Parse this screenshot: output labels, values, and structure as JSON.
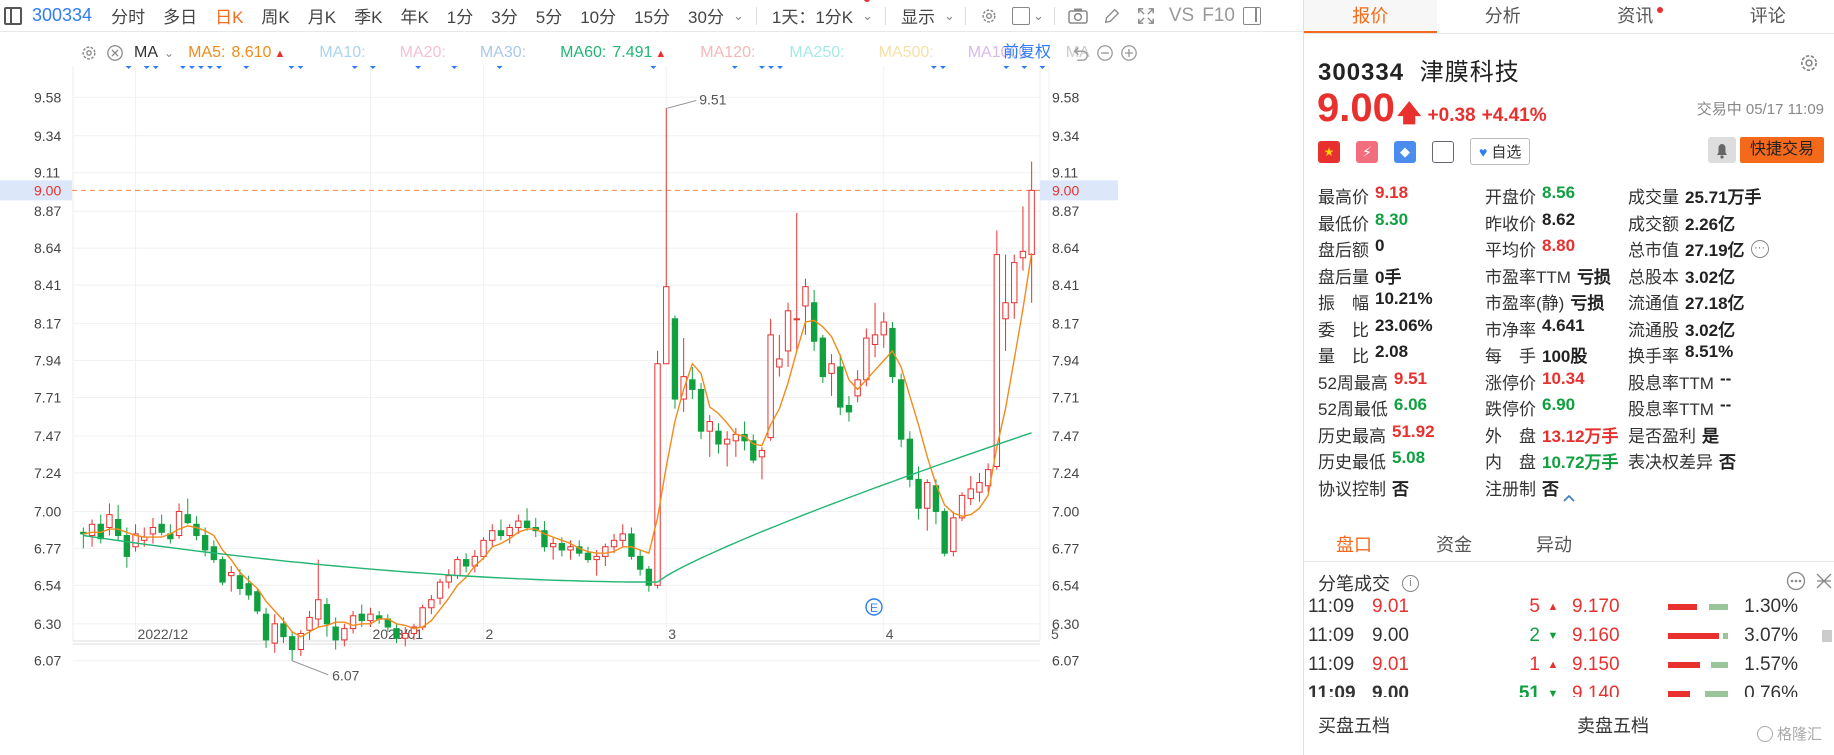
{
  "toolbar": {
    "code": "300334",
    "periods": [
      "分时",
      "多日",
      "日K",
      "周K",
      "月K",
      "季K",
      "年K",
      "1分",
      "3分",
      "5分",
      "10分",
      "15分",
      "30分"
    ],
    "active_period": "日K",
    "interval_select": "1天：1分K",
    "display_label": "显示",
    "vs_label": "VS",
    "f10_label": "F10"
  },
  "ma_bar": {
    "label": "MA",
    "items": [
      {
        "name": "MA5:",
        "value": "8.610",
        "color": "#f28a1c",
        "arrow": "▲"
      },
      {
        "name": "MA10:",
        "value": "",
        "color": "#a9d4f2"
      },
      {
        "name": "MA20:",
        "value": "",
        "color": "#f5c0d8"
      },
      {
        "name": "MA30:",
        "value": "",
        "color": "#a9c8ec"
      },
      {
        "name": "MA60:",
        "value": "7.491",
        "color": "#22b573",
        "arrow": "▲"
      },
      {
        "name": "MA120:",
        "value": "",
        "color": "#f5b8b8"
      },
      {
        "name": "MA250:",
        "value": "",
        "color": "#a8e8e8"
      },
      {
        "name": "MA500:",
        "value": "",
        "color": "#f8e0a8"
      },
      {
        "name": "MA1000:",
        "value": "",
        "color": "#d8b8e8"
      },
      {
        "name": "MA",
        "value": "",
        "color": "#cccccc"
      }
    ],
    "adjust_label": "前复权"
  },
  "chart_data": {
    "type": "candlestick",
    "y_ticks": [
      9.58,
      9.34,
      9.11,
      8.87,
      8.64,
      8.41,
      8.17,
      7.94,
      7.71,
      7.47,
      7.24,
      7.0,
      6.77,
      6.54,
      6.3,
      6.07
    ],
    "ylim": [
      5.95,
      9.7
    ],
    "x_ticks": [
      "2022/12",
      "2023/01",
      "2",
      "3",
      "4",
      "5"
    ],
    "current_price_line": "9.00",
    "max_annotation": "9.51",
    "min_annotation": "6.07",
    "candles": [
      [
        6.87,
        6.9,
        6.77,
        6.86
      ],
      [
        6.85,
        6.95,
        6.78,
        6.92
      ],
      [
        6.92,
        6.98,
        6.8,
        6.83
      ],
      [
        6.9,
        7.05,
        6.85,
        6.98
      ],
      [
        6.95,
        7.04,
        6.82,
        6.85
      ],
      [
        6.85,
        6.9,
        6.65,
        6.72
      ],
      [
        6.78,
        6.92,
        6.75,
        6.86
      ],
      [
        6.82,
        6.9,
        6.78,
        6.84
      ],
      [
        6.86,
        6.96,
        6.8,
        6.9
      ],
      [
        6.92,
        6.98,
        6.85,
        6.87
      ],
      [
        6.86,
        6.92,
        6.8,
        6.83
      ],
      [
        6.85,
        7.05,
        6.83,
        7.0
      ],
      [
        6.98,
        7.08,
        6.92,
        6.93
      ],
      [
        6.92,
        6.97,
        6.82,
        6.85
      ],
      [
        6.85,
        6.9,
        6.72,
        6.76
      ],
      [
        6.78,
        6.82,
        6.68,
        6.7
      ],
      [
        6.7,
        6.72,
        6.54,
        6.56
      ],
      [
        6.6,
        6.66,
        6.5,
        6.62
      ],
      [
        6.6,
        6.64,
        6.48,
        6.52
      ],
      [
        6.55,
        6.6,
        6.45,
        6.48
      ],
      [
        6.5,
        6.52,
        6.36,
        6.38
      ],
      [
        6.36,
        6.4,
        6.15,
        6.2
      ],
      [
        6.18,
        6.36,
        6.12,
        6.3
      ],
      [
        6.3,
        6.34,
        6.18,
        6.22
      ],
      [
        6.22,
        6.25,
        6.07,
        6.14
      ],
      [
        6.14,
        6.26,
        6.1,
        6.24
      ],
      [
        6.26,
        6.38,
        6.2,
        6.34
      ],
      [
        6.33,
        6.7,
        6.28,
        6.45
      ],
      [
        6.42,
        6.46,
        6.22,
        6.3
      ],
      [
        6.28,
        6.34,
        6.14,
        6.2
      ],
      [
        6.2,
        6.3,
        6.16,
        6.27
      ],
      [
        6.27,
        6.38,
        6.24,
        6.35
      ],
      [
        6.36,
        6.42,
        6.28,
        6.32
      ],
      [
        6.32,
        6.4,
        6.28,
        6.36
      ],
      [
        6.35,
        6.38,
        6.3,
        6.33
      ],
      [
        6.33,
        6.36,
        6.25,
        6.28
      ],
      [
        6.27,
        6.3,
        6.18,
        6.21
      ],
      [
        6.21,
        6.28,
        6.16,
        6.24
      ],
      [
        6.24,
        6.3,
        6.2,
        6.28
      ],
      [
        6.28,
        6.42,
        6.26,
        6.4
      ],
      [
        6.4,
        6.48,
        6.36,
        6.45
      ],
      [
        6.46,
        6.58,
        6.42,
        6.56
      ],
      [
        6.56,
        6.64,
        6.52,
        6.6
      ],
      [
        6.6,
        6.72,
        6.58,
        6.7
      ],
      [
        6.7,
        6.74,
        6.62,
        6.66
      ],
      [
        6.66,
        6.76,
        6.62,
        6.72
      ],
      [
        6.72,
        6.84,
        6.7,
        6.82
      ],
      [
        6.82,
        6.92,
        6.78,
        6.88
      ],
      [
        6.88,
        6.95,
        6.82,
        6.85
      ],
      [
        6.85,
        6.92,
        6.8,
        6.9
      ],
      [
        6.9,
        6.98,
        6.86,
        6.94
      ],
      [
        6.94,
        7.02,
        6.88,
        6.9
      ],
      [
        6.9,
        6.96,
        6.84,
        6.88
      ],
      [
        6.88,
        6.94,
        6.75,
        6.78
      ],
      [
        6.78,
        6.84,
        6.7,
        6.8
      ],
      [
        6.8,
        6.84,
        6.72,
        6.76
      ],
      [
        6.76,
        6.82,
        6.7,
        6.78
      ],
      [
        6.78,
        6.82,
        6.72,
        6.74
      ],
      [
        6.74,
        6.78,
        6.68,
        6.7
      ],
      [
        6.7,
        6.76,
        6.6,
        6.72
      ],
      [
        6.72,
        6.8,
        6.66,
        6.78
      ],
      [
        6.78,
        6.86,
        6.74,
        6.82
      ],
      [
        6.82,
        6.92,
        6.78,
        6.86
      ],
      [
        6.86,
        6.9,
        6.7,
        6.72
      ],
      [
        6.72,
        6.76,
        6.6,
        6.64
      ],
      [
        6.64,
        6.66,
        6.5,
        6.54
      ],
      [
        6.54,
        8.0,
        6.52,
        7.92
      ],
      [
        7.92,
        9.51,
        8.1,
        8.4
      ],
      [
        8.2,
        8.22,
        7.64,
        7.7
      ],
      [
        7.7,
        8.08,
        7.62,
        7.84
      ],
      [
        7.82,
        7.9,
        7.7,
        7.76
      ],
      [
        7.76,
        7.8,
        7.45,
        7.5
      ],
      [
        7.5,
        7.6,
        7.34,
        7.56
      ],
      [
        7.5,
        7.55,
        7.36,
        7.42
      ],
      [
        7.42,
        7.5,
        7.28,
        7.45
      ],
      [
        7.44,
        7.52,
        7.34,
        7.48
      ],
      [
        7.48,
        7.56,
        7.38,
        7.44
      ],
      [
        7.44,
        7.48,
        7.3,
        7.32
      ],
      [
        7.34,
        7.4,
        7.2,
        7.38
      ],
      [
        7.46,
        8.2,
        7.44,
        8.1
      ],
      [
        7.9,
        8.1,
        7.84,
        7.95
      ],
      [
        8.0,
        8.3,
        7.9,
        8.25
      ],
      [
        8.2,
        8.86,
        8.0,
        8.2
      ],
      [
        8.28,
        8.45,
        8.1,
        8.4
      ],
      [
        8.3,
        8.38,
        8.0,
        8.06
      ],
      [
        8.08,
        8.1,
        7.8,
        7.84
      ],
      [
        7.86,
        7.98,
        7.72,
        7.92
      ],
      [
        7.9,
        7.98,
        7.6,
        7.65
      ],
      [
        7.66,
        7.72,
        7.56,
        7.62
      ],
      [
        7.72,
        7.88,
        7.68,
        7.82
      ],
      [
        7.82,
        8.14,
        7.78,
        8.08
      ],
      [
        8.04,
        8.3,
        7.96,
        8.1
      ],
      [
        8.1,
        8.24,
        8.02,
        8.18
      ],
      [
        8.14,
        8.18,
        7.8,
        7.84
      ],
      [
        7.82,
        7.86,
        7.4,
        7.45
      ],
      [
        7.45,
        7.5,
        7.15,
        7.2
      ],
      [
        7.2,
        7.28,
        6.95,
        7.02
      ],
      [
        7.02,
        7.2,
        6.88,
        7.18
      ],
      [
        7.16,
        7.2,
        6.92,
        7.0
      ],
      [
        7.0,
        7.02,
        6.72,
        6.74
      ],
      [
        6.75,
        7.0,
        6.72,
        6.96
      ],
      [
        6.96,
        7.12,
        6.94,
        7.1
      ],
      [
        7.08,
        7.22,
        7.04,
        7.14
      ],
      [
        7.12,
        7.24,
        7.06,
        7.18
      ],
      [
        7.16,
        7.3,
        7.12,
        7.26
      ],
      [
        7.28,
        8.75,
        7.26,
        8.6
      ],
      [
        8.2,
        8.6,
        8.0,
        8.3
      ],
      [
        8.3,
        8.6,
        8.2,
        8.55
      ],
      [
        8.58,
        8.9,
        8.5,
        8.62
      ],
      [
        8.6,
        9.18,
        8.3,
        9.0
      ]
    ],
    "ma5": [
      6.86,
      6.87,
      6.87,
      6.89,
      6.89,
      6.87,
      6.85,
      6.84,
      6.84,
      6.84,
      6.86,
      6.89,
      6.91,
      6.9,
      6.88,
      6.85,
      6.76,
      6.7,
      6.62,
      6.57,
      6.52,
      6.44,
      6.38,
      6.32,
      6.25,
      6.22,
      6.25,
      6.28,
      6.29,
      6.31,
      6.31,
      6.29,
      6.3,
      6.3,
      6.33,
      6.33,
      6.3,
      6.29,
      6.27,
      6.28,
      6.32,
      6.39,
      6.46,
      6.54,
      6.59,
      6.66,
      6.71,
      6.78,
      6.8,
      6.83,
      6.87,
      6.89,
      6.89,
      6.86,
      6.84,
      6.82,
      6.8,
      6.77,
      6.75,
      6.74,
      6.74,
      6.75,
      6.78,
      6.78,
      6.76,
      6.74,
      6.96,
      7.28,
      7.56,
      7.76,
      7.92,
      7.86,
      7.65,
      7.61,
      7.55,
      7.48,
      7.47,
      7.42,
      7.41,
      7.54,
      7.64,
      7.8,
      8.0,
      8.18,
      8.19,
      8.15,
      8.09,
      7.97,
      7.82,
      7.76,
      7.82,
      7.88,
      7.94,
      8.0,
      7.9,
      7.72,
      7.54,
      7.34,
      7.17,
      7.04,
      6.99,
      6.97,
      6.98,
      7.02,
      7.1,
      7.4,
      7.64,
      7.95,
      8.26,
      8.61
    ],
    "ma60_endpoints": [
      6.85,
      6.56,
      7.49
    ]
  },
  "side_tabs": [
    "报价",
    "分析",
    "资讯",
    "评论"
  ],
  "stock": {
    "code": "300334",
    "name": "津膜科技",
    "price": "9.00",
    "change": "+0.38",
    "change_pct": "+4.41%",
    "status_time": "交易中 05/17 11:09"
  },
  "actions": {
    "watch": "自选",
    "quick_trade": "快捷交易"
  },
  "stats": [
    [
      {
        "l": "最高价",
        "v": "9.18",
        "c": "red"
      },
      {
        "l": "开盘价",
        "v": "8.56",
        "c": "green"
      },
      {
        "l": "成交量",
        "v": "25.71万手",
        "c": "dark"
      }
    ],
    [
      {
        "l": "最低价",
        "v": "8.30",
        "c": "green"
      },
      {
        "l": "昨收价",
        "v": "8.62",
        "c": "dark"
      },
      {
        "l": "成交额",
        "v": "2.26亿",
        "c": "dark"
      }
    ],
    [
      {
        "l": "盘后额",
        "v": "0",
        "c": "dark"
      },
      {
        "l": "平均价",
        "v": "8.80",
        "c": "red"
      },
      {
        "l": "总市值",
        "v": "27.19亿",
        "c": "dark"
      }
    ],
    [
      {
        "l": "盘后量",
        "v": "0手",
        "c": "dark"
      },
      {
        "l": "市盈率TTM",
        "v": "亏损",
        "c": "dark"
      },
      {
        "l": "总股本",
        "v": "3.02亿",
        "c": "dark"
      }
    ],
    [
      {
        "l": "振　幅",
        "v": "10.21%",
        "c": "dark"
      },
      {
        "l": "市盈率(静)",
        "v": "亏损",
        "c": "dark"
      },
      {
        "l": "流通值",
        "v": "27.18亿",
        "c": "dark"
      }
    ],
    [
      {
        "l": "委　比",
        "v": "23.06%",
        "c": "dark"
      },
      {
        "l": "市净率",
        "v": "4.641",
        "c": "dark"
      },
      {
        "l": "流通股",
        "v": "3.02亿",
        "c": "dark"
      }
    ],
    [
      {
        "l": "量　比",
        "v": "2.08",
        "c": "dark"
      },
      {
        "l": "每　手",
        "v": "100股",
        "c": "dark"
      },
      {
        "l": "换手率",
        "v": "8.51%",
        "c": "dark"
      }
    ],
    [
      {
        "l": "52周最高",
        "v": "9.51",
        "c": "red"
      },
      {
        "l": "涨停价",
        "v": "10.34",
        "c": "red"
      },
      {
        "l": "股息率TTM",
        "v": "--",
        "c": "dark"
      }
    ],
    [
      {
        "l": "52周最低",
        "v": "6.06",
        "c": "green"
      },
      {
        "l": "跌停价",
        "v": "6.90",
        "c": "green"
      },
      {
        "l": "股息率TTM",
        "v": "--",
        "c": "dark"
      }
    ],
    [
      {
        "l": "历史最高",
        "v": "51.92",
        "c": "red"
      },
      {
        "l": "外　盘",
        "v": "13.12万手",
        "c": "red"
      },
      {
        "l": "是否盈利",
        "v": "是",
        "c": "dark"
      }
    ],
    [
      {
        "l": "历史最低",
        "v": "5.08",
        "c": "green"
      },
      {
        "l": "内　盘",
        "v": "10.72万手",
        "c": "green"
      },
      {
        "l": "表决权差异",
        "v": "否",
        "c": "dark"
      }
    ],
    [
      {
        "l": "协议控制",
        "v": "否",
        "c": "dark"
      },
      {
        "l": "注册制",
        "v": "否",
        "c": "dark"
      },
      {
        "l": "",
        "v": "",
        "c": "dark"
      }
    ]
  ],
  "sub_tabs": [
    "盘口",
    "资金",
    "异动"
  ],
  "ticks_title": "分笔成交",
  "ticks": [
    {
      "time": "11:09",
      "price": "9.01",
      "vol": "5",
      "dir": "up"
    },
    {
      "time": "11:09",
      "price": "9.00",
      "vol": "2",
      "dir": "down"
    },
    {
      "time": "11:09",
      "price": "9.01",
      "vol": "1",
      "dir": "up"
    },
    {
      "time": "11:09",
      "price": "9.00",
      "vol": "51",
      "dir": "down"
    }
  ],
  "depth": [
    {
      "price": "9.170",
      "pct": "1.30%"
    },
    {
      "price": "9.160",
      "pct": "3.07%"
    },
    {
      "price": "9.150",
      "pct": "1.57%"
    },
    {
      "price": "9.140",
      "pct": "0.76%"
    }
  ],
  "book": {
    "buy": "买盘五档",
    "sell": "卖盘五档"
  },
  "watermark": "格隆汇",
  "colors": {
    "up": "#e8312f",
    "down": "#10a040",
    "accent": "#f56a1a",
    "ma5": "#f28a1c",
    "ma60": "#22b573",
    "link": "#2e7cf6"
  }
}
